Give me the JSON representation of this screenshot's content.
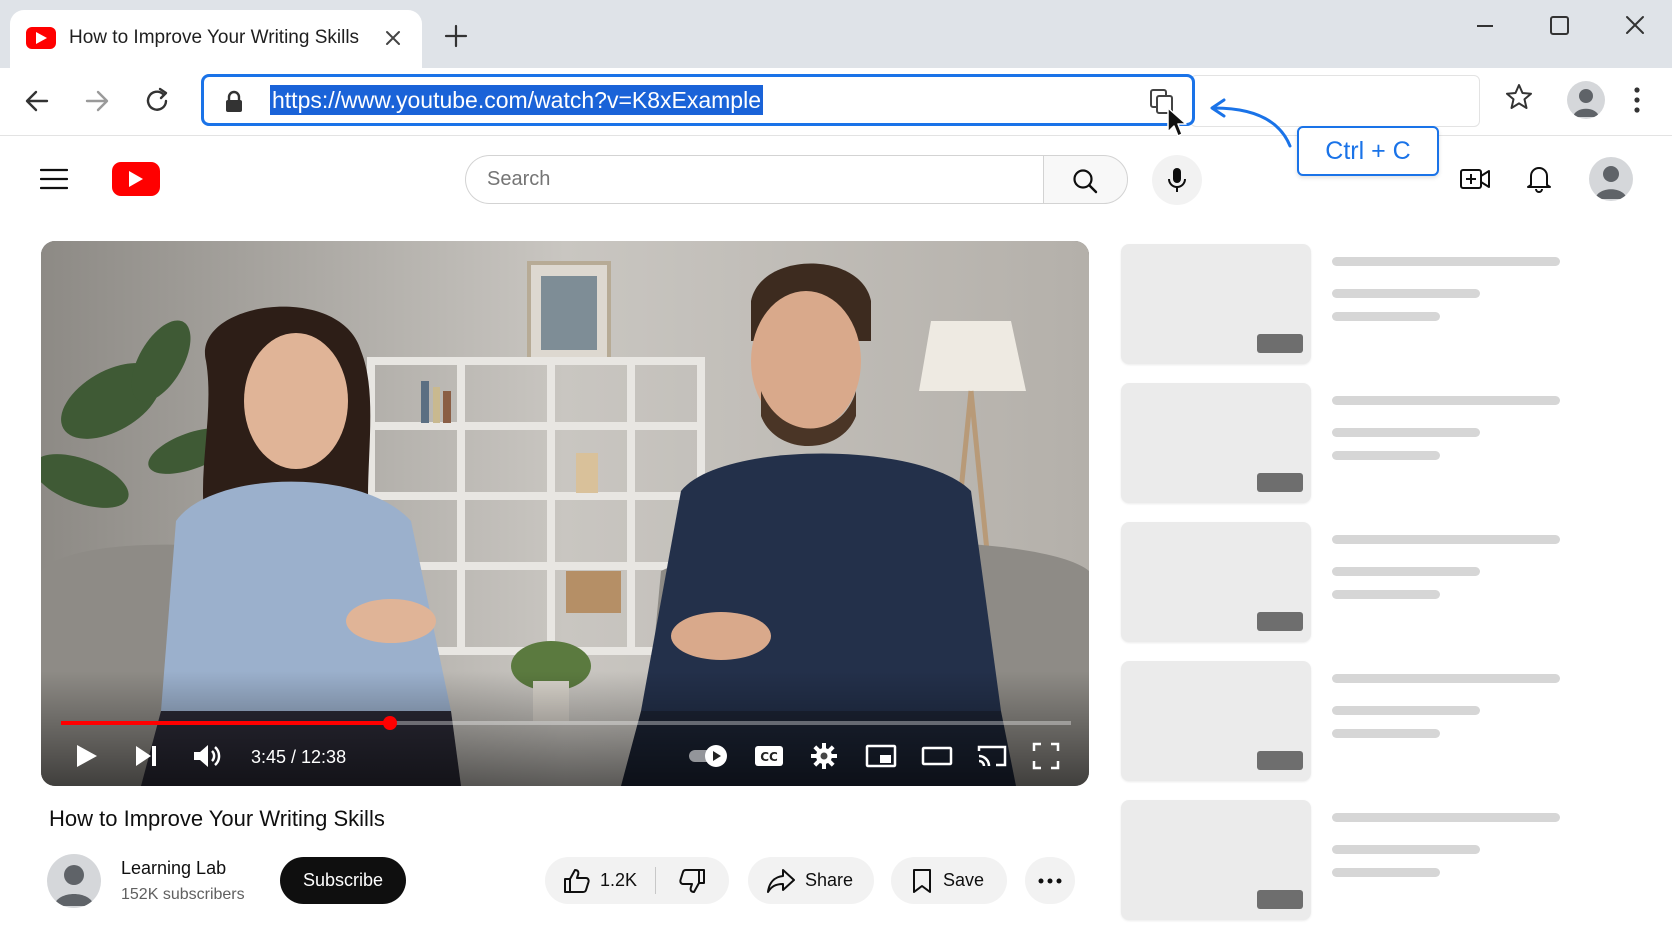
{
  "browser": {
    "tab_title": "How to Improve Your Writing Skills",
    "url": "https://www.youtube.com/watch?v=K8xExample",
    "hint_label": "Ctrl + C"
  },
  "youtube": {
    "search": {
      "placeholder": "Search"
    },
    "player": {
      "time": "3:45 / 12:38",
      "progress": 0.326
    },
    "video": {
      "title": "How to Improve Your Writing Skills",
      "channel": "Learning Lab",
      "subscribers": "152K subscribers",
      "subscribe_label": "Subscribe",
      "likes": "1.2K",
      "share_label": "Share",
      "save_label": "Save"
    }
  },
  "colors": {
    "brand_red": "#ff0000",
    "accent_blue": "#1a73e8",
    "url_highlight": "#1a63d8"
  },
  "icons": [
    "youtube-favicon",
    "close-icon",
    "plus-icon",
    "minimize-icon",
    "maximize-icon",
    "back-icon",
    "forward-icon",
    "reload-icon",
    "lock-icon",
    "copy-icon",
    "star-icon",
    "profile-icon",
    "kebab-icon",
    "hamburger-icon",
    "youtube-logo",
    "search-icon",
    "mic-icon",
    "create-icon",
    "bell-icon",
    "play-icon",
    "next-icon",
    "volume-icon",
    "autoplay-toggle",
    "cc-icon",
    "settings-icon",
    "miniplayer-icon",
    "theater-icon",
    "cast-icon",
    "fullscreen-icon",
    "like-icon",
    "dislike-icon",
    "share-icon",
    "save-icon",
    "more-icon"
  ]
}
